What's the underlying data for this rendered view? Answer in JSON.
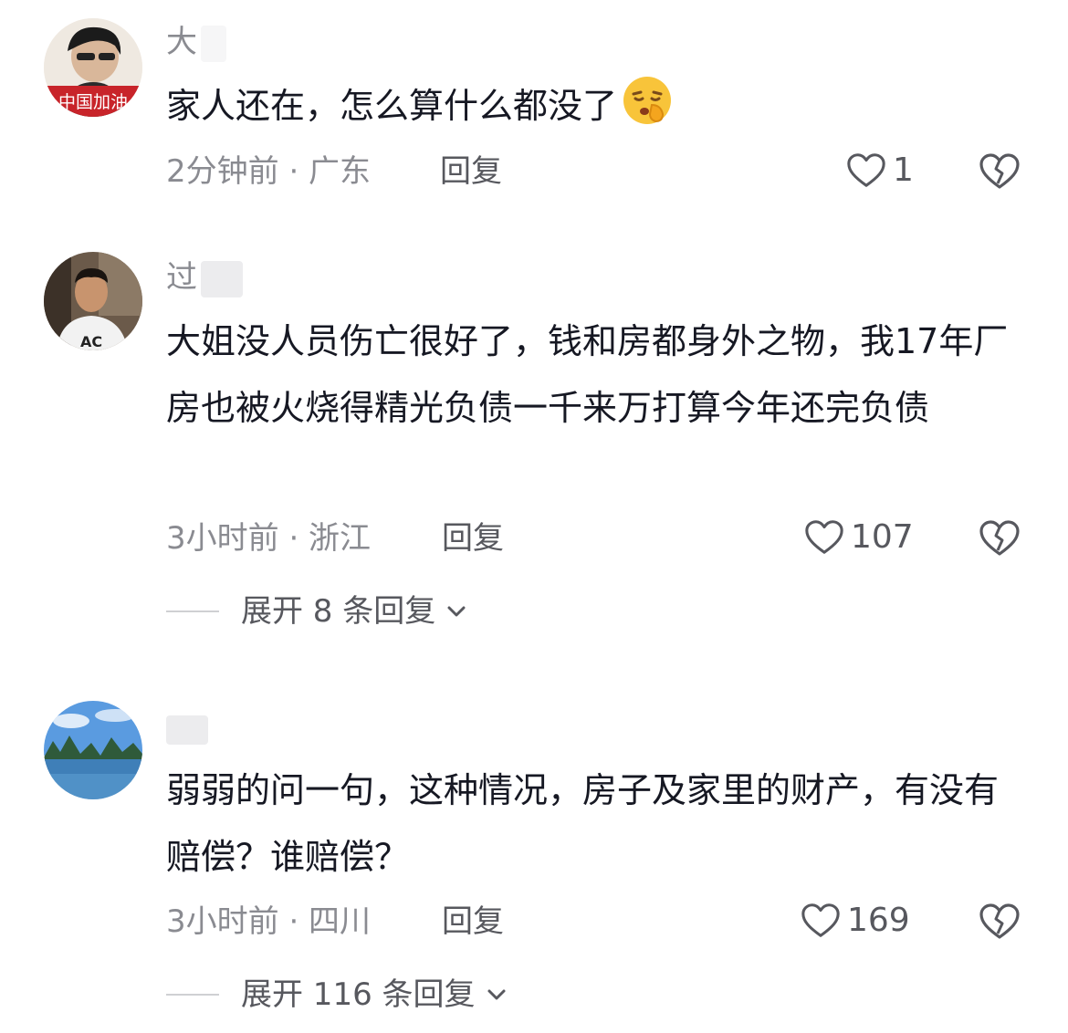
{
  "comments": [
    {
      "username": "大",
      "avatar_caption": "中国加油",
      "text": "家人还在，怎么算什么都没了",
      "emoji": "shushing-face-emoji",
      "meta": "2分钟前 · 广东",
      "reply": "回复",
      "likes": "1"
    },
    {
      "username": "过",
      "text": "大姐没人员伤亡很好了，钱和房都身外之物，我17年厂房也被火烧得精光负债一千来万打算今年还完负债",
      "meta": "3小时前 · 浙江",
      "reply": "回复",
      "likes": "107",
      "expand": "展开 8 条回复"
    },
    {
      "username": "",
      "text": "弱弱的问一句，这种情况，房子及家里的财产，有没有赔偿？谁赔偿？",
      "meta": "3小时前 · 四川",
      "reply": "回复",
      "likes": "169",
      "expand": "展开 116 条回复"
    }
  ]
}
